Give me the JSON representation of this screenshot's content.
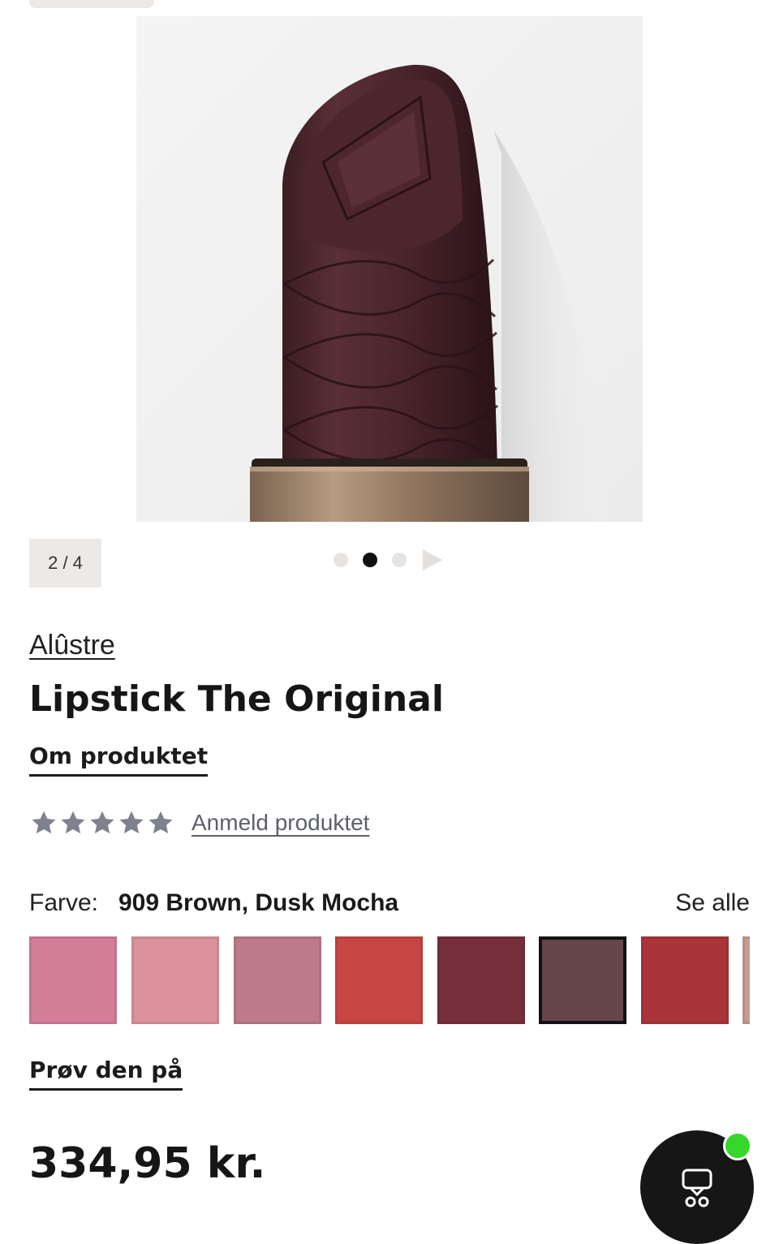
{
  "gallery": {
    "image_alt": "Lipstick product image",
    "counter": "2 / 4",
    "dots": [
      false,
      true,
      false
    ]
  },
  "product": {
    "brand": "Alûstre",
    "title": "Lipstick The Original",
    "about_link": "Om produktet",
    "rating_stars": 5,
    "rating_filled": 0,
    "review_link": "Anmeld produktet"
  },
  "color": {
    "label": "Farve:",
    "selected": "909 Brown, Dusk Mocha",
    "see_all": "Se alle",
    "swatches": [
      {
        "hex": "#d37d99",
        "selected": false
      },
      {
        "hex": "#dc929d",
        "selected": false
      },
      {
        "hex": "#bc7a8b",
        "selected": false
      },
      {
        "hex": "#c74643",
        "selected": false
      },
      {
        "hex": "#772e3b",
        "selected": false
      },
      {
        "hex": "#664649",
        "selected": true
      },
      {
        "hex": "#a9353a",
        "selected": false
      },
      {
        "hex": "#c79c92",
        "selected": false
      }
    ]
  },
  "try_on": "Prøv den på",
  "price": "334,95 kr.",
  "colors": {
    "star": "#7e828e",
    "fab": "#161616",
    "badge": "#36d62a"
  }
}
